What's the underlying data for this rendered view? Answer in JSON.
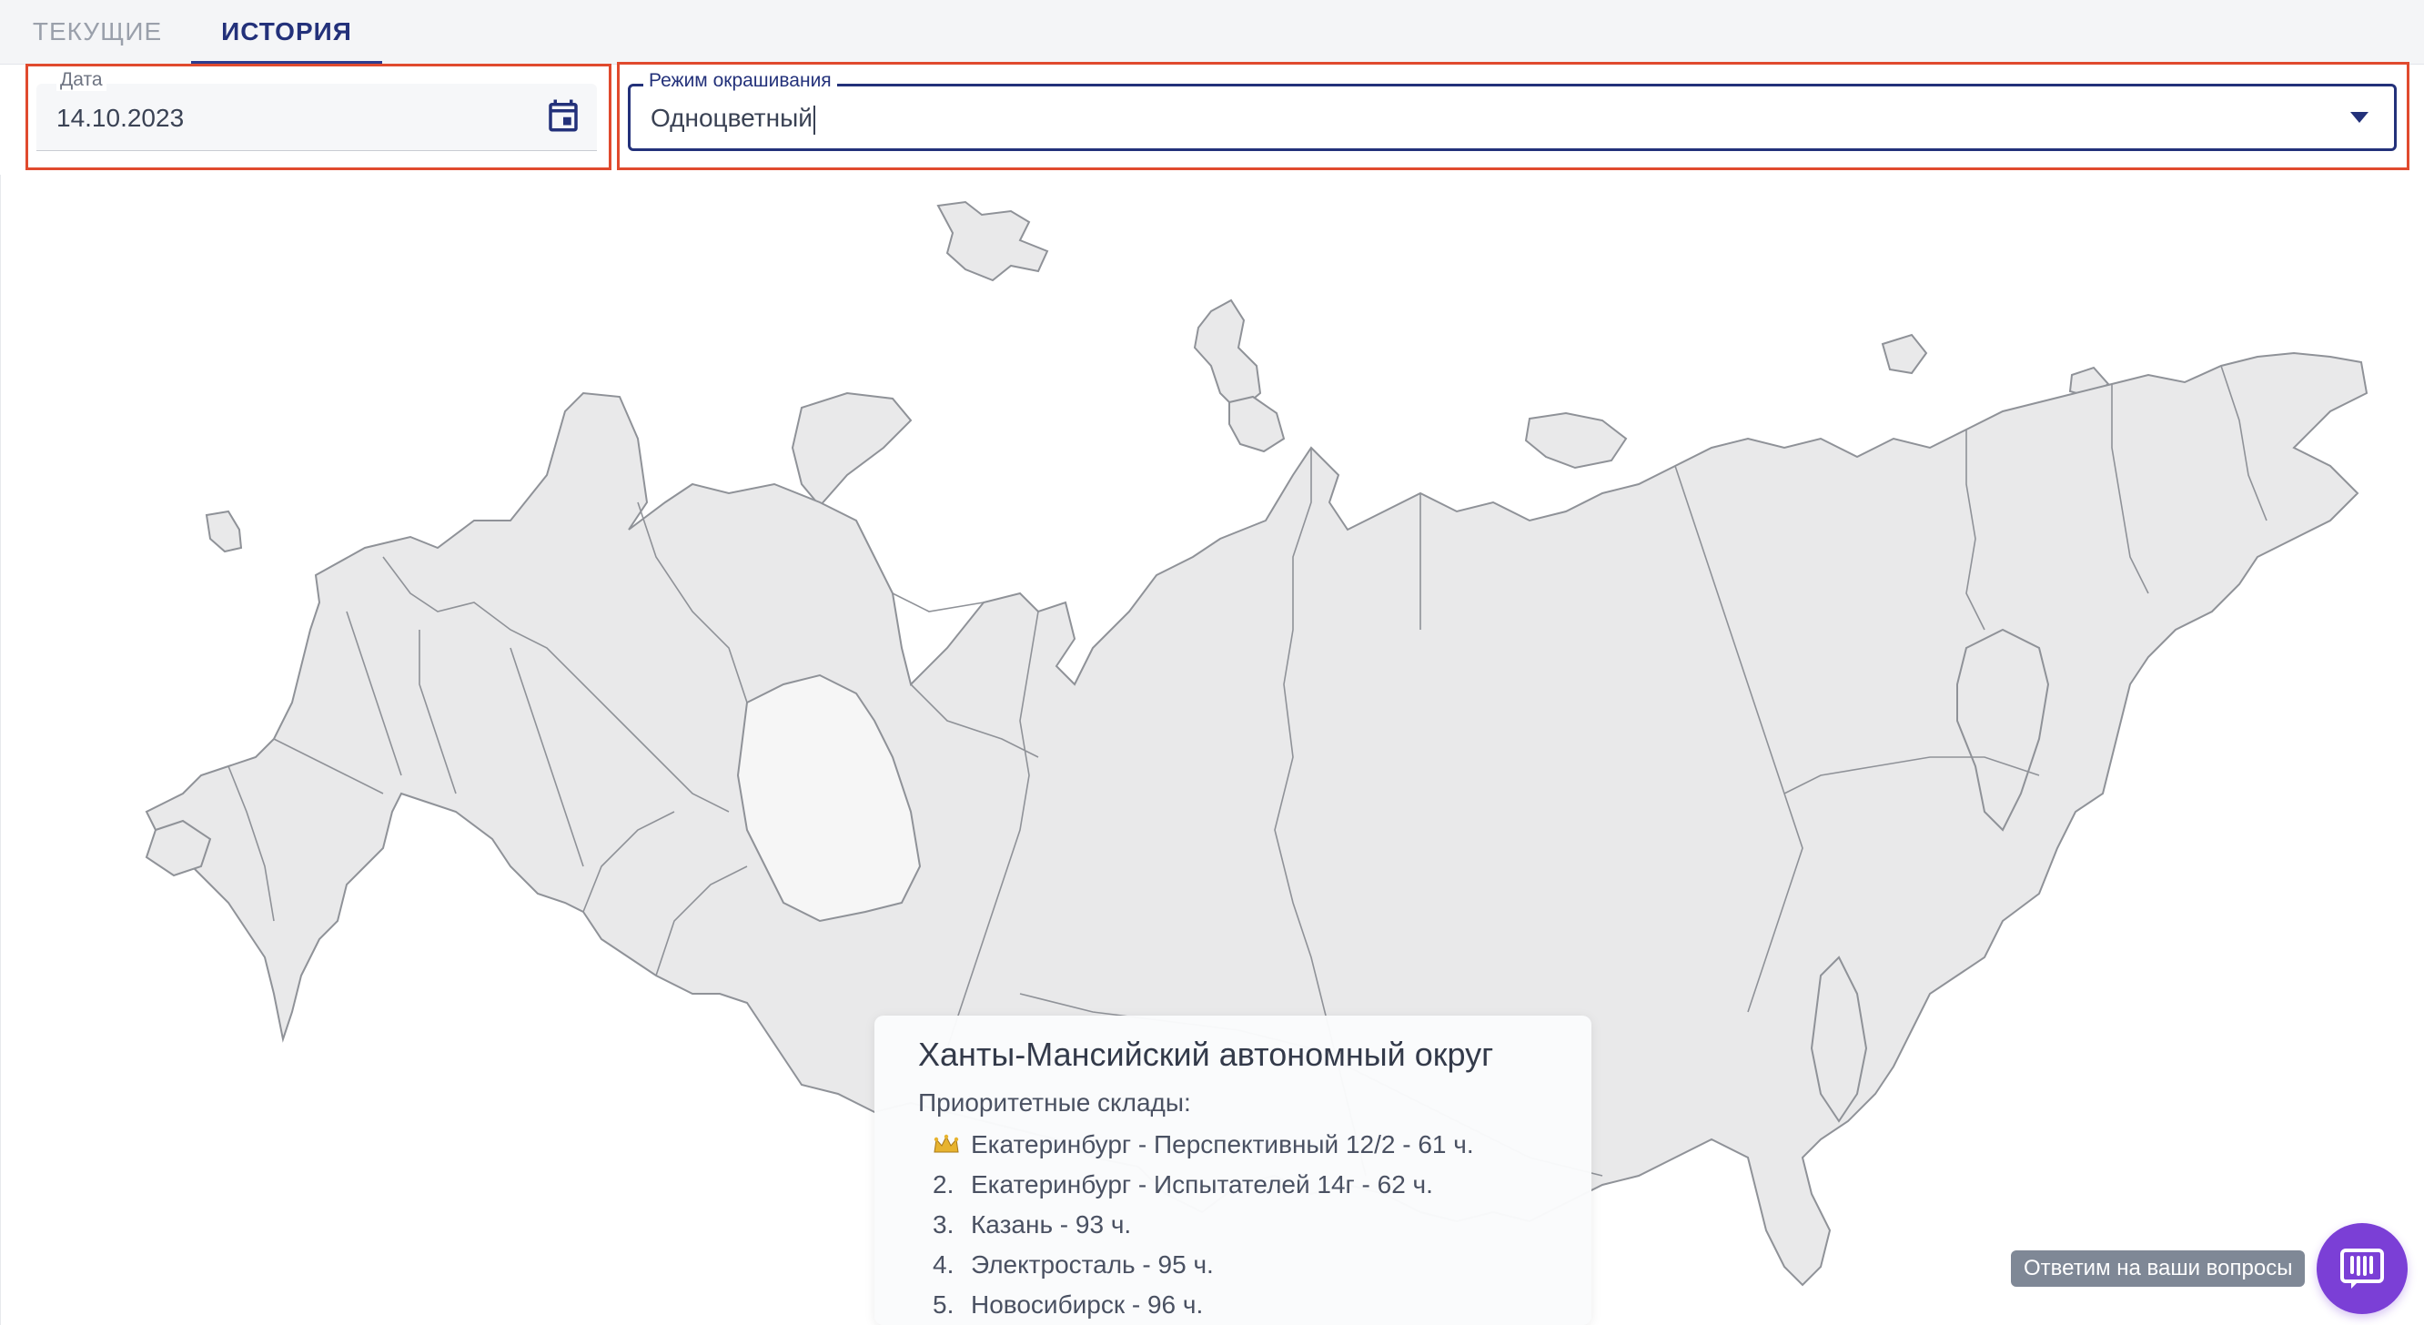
{
  "tabs": {
    "current": "ТЕКУЩИЕ",
    "history": "ИСТОРИЯ",
    "active": "history"
  },
  "filters": {
    "date": {
      "label": "Дата",
      "value": "14.10.2023"
    },
    "mode": {
      "label": "Режим окрашивания",
      "value": "Одноцветный"
    }
  },
  "tooltip": {
    "region": "Ханты-Мансийский автономный округ",
    "subtitle": "Приоритетные склады:",
    "items": [
      {
        "rank": "crown",
        "text": "Екатеринбург - Перспективный 12/2 - 61 ч."
      },
      {
        "rank": "2.",
        "text": "Екатеринбург - Испытателей 14г - 62 ч."
      },
      {
        "rank": "3.",
        "text": "Казань - 93 ч."
      },
      {
        "rank": "4.",
        "text": "Электросталь - 95 ч."
      },
      {
        "rank": "5.",
        "text": "Новосибирск - 96 ч."
      }
    ]
  },
  "chat": {
    "label": "Ответим на ваши вопросы"
  },
  "icons": {
    "calendar": "calendar-icon",
    "dropdown": "chevron-down-icon",
    "crown": "crown-icon",
    "chat": "chat-icon"
  },
  "colors": {
    "accent": "#23317a",
    "highlight": "#e04a2e",
    "region_fill": "#e9e9ea",
    "region_stroke": "#8f9298",
    "chat": "#7b3fd6"
  }
}
